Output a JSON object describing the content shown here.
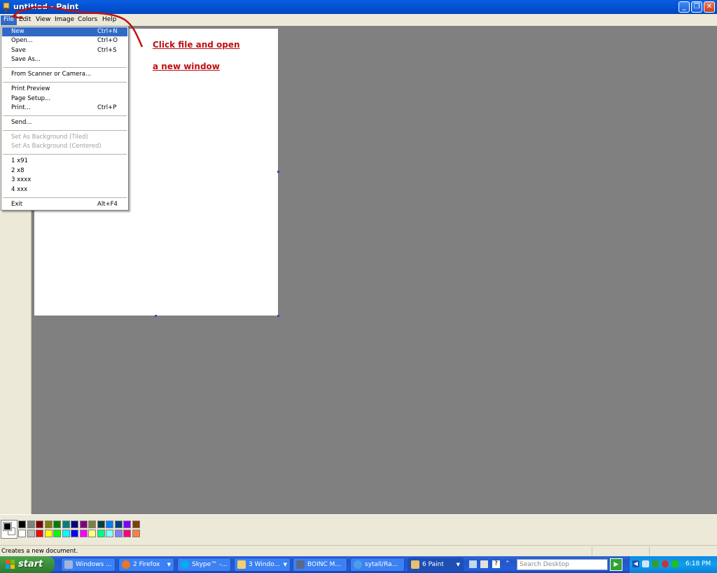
{
  "window": {
    "title": "untitled - Paint",
    "minimize_icon": "minimize-icon",
    "maximize_icon": "restore-icon",
    "close_icon": "close-icon"
  },
  "menubar": [
    "File",
    "Edit",
    "View",
    "Image",
    "Colors",
    "Help"
  ],
  "file_menu": {
    "items": [
      {
        "label": "New",
        "shortcut": "Ctrl+N",
        "state": "highlighted"
      },
      {
        "label": "Open...",
        "shortcut": "Ctrl+O"
      },
      {
        "label": "Save",
        "shortcut": "Ctrl+S"
      },
      {
        "label": "Save As...",
        "shortcut": ""
      },
      {
        "label": "From Scanner or Camera...",
        "shortcut": ""
      },
      {
        "label": "Print Preview",
        "shortcut": ""
      },
      {
        "label": "Page Setup...",
        "shortcut": ""
      },
      {
        "label": "Print...",
        "shortcut": "Ctrl+P"
      },
      {
        "label": "Send...",
        "shortcut": ""
      },
      {
        "label": "Set As Background (Tiled)",
        "shortcut": "",
        "state": "disabled"
      },
      {
        "label": "Set As Background (Centered)",
        "shortcut": "",
        "state": "disabled"
      },
      {
        "label": "1 x91",
        "shortcut": ""
      },
      {
        "label": "2 x8",
        "shortcut": ""
      },
      {
        "label": "3 xxxx",
        "shortcut": ""
      },
      {
        "label": "4 xxx",
        "shortcut": ""
      },
      {
        "label": "Exit",
        "shortcut": "Alt+F4"
      }
    ]
  },
  "annotation": {
    "line1": "Click file and open",
    "line2": "a new window",
    "color": "#c01010"
  },
  "palette": {
    "foreground": "#000000",
    "background": "#ffffff",
    "colors_top": [
      "#000000",
      "#808080",
      "#800000",
      "#808000",
      "#008000",
      "#008080",
      "#000080",
      "#800080",
      "#808040",
      "#004040",
      "#0080ff",
      "#004080",
      "#8000ff",
      "#804000"
    ],
    "colors_bottom": [
      "#ffffff",
      "#c0c0c0",
      "#ff0000",
      "#ffff00",
      "#00ff00",
      "#00ffff",
      "#0000ff",
      "#ff00ff",
      "#ffff80",
      "#00ff80",
      "#80ffff",
      "#8080ff",
      "#ff0080",
      "#ff8040"
    ]
  },
  "statusbar": {
    "text": "Creates a new document."
  },
  "taskbar": {
    "start_label": "start",
    "buttons": [
      {
        "label": "Windows ...",
        "icon": "windows-explorer-icon"
      },
      {
        "label": "2 Firefox",
        "icon": "firefox-icon",
        "group": true
      },
      {
        "label": "Skype™ -...",
        "icon": "skype-icon"
      },
      {
        "label": "3 Windo...",
        "icon": "folder-icon",
        "group": true
      },
      {
        "label": "BOINC M...",
        "icon": "boinc-icon"
      },
      {
        "label": "sytall/Ra...",
        "icon": "internet-explorer-icon"
      },
      {
        "label": "6 Paint",
        "icon": "paint-icon",
        "group": true,
        "active": true
      }
    ],
    "search_placeholder": "Search Desktop",
    "clock": "6:18 PM"
  }
}
